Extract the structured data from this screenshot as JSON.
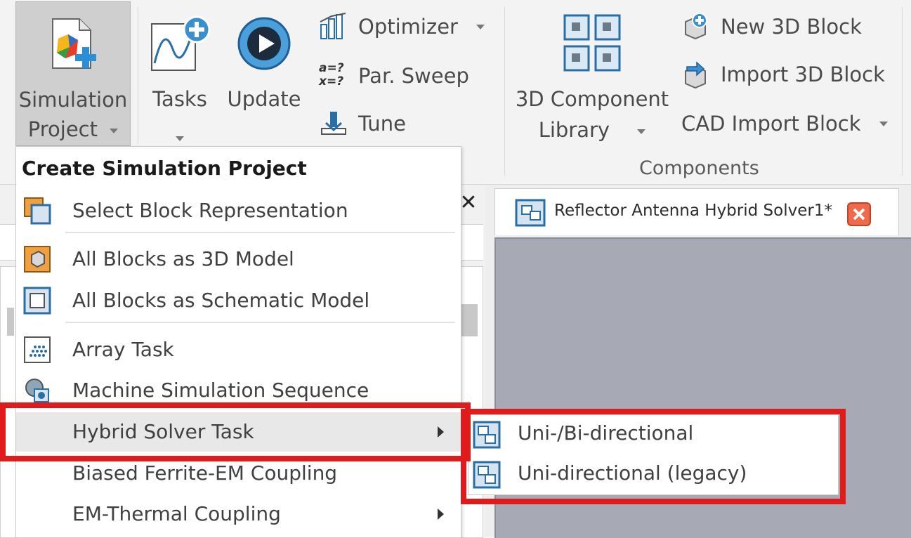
{
  "ribbon": {
    "simulation_project": {
      "line1": "Simulation",
      "line2": "Project"
    },
    "tasks": {
      "label": "Tasks"
    },
    "update": {
      "label": "Update"
    },
    "optimizer": {
      "label": "Optimizer"
    },
    "par_sweep": {
      "label": "Par. Sweep",
      "icon_text_top": "a=?",
      "icon_text_bottom": "x=?"
    },
    "tune": {
      "label": "Tune"
    },
    "component_library": {
      "line1": "3D Component",
      "line2": "Library"
    },
    "new_3d_block": {
      "label": "New 3D Block"
    },
    "import_3d_block": {
      "label": "Import 3D Block"
    },
    "cad_import_block": {
      "label": "CAD Import Block"
    },
    "components_group": {
      "label": "Components"
    }
  },
  "document_tab": {
    "title": "Reflector Antenna Hybrid Solver1*"
  },
  "pane": {
    "close_glyph": "✕"
  },
  "menu": {
    "header": "Create Simulation Project",
    "items": [
      {
        "label": "Select Block Representation"
      },
      {
        "label": "All Blocks as 3D Model"
      },
      {
        "label": "All Blocks as Schematic Model"
      },
      {
        "label": "Array Task"
      },
      {
        "label": "Machine Simulation Sequence"
      },
      {
        "label": "Hybrid Solver Task"
      },
      {
        "label": "Biased Ferrite-EM Coupling"
      },
      {
        "label": "EM-Thermal Coupling"
      }
    ]
  },
  "submenu": {
    "items": [
      {
        "label": "Uni-/Bi-directional"
      },
      {
        "label": "Uni-directional (legacy)"
      }
    ]
  },
  "colors": {
    "highlight": "#e01b1b",
    "viewport": "#a7a9b5",
    "accent_blue": "#2a6ea6"
  }
}
